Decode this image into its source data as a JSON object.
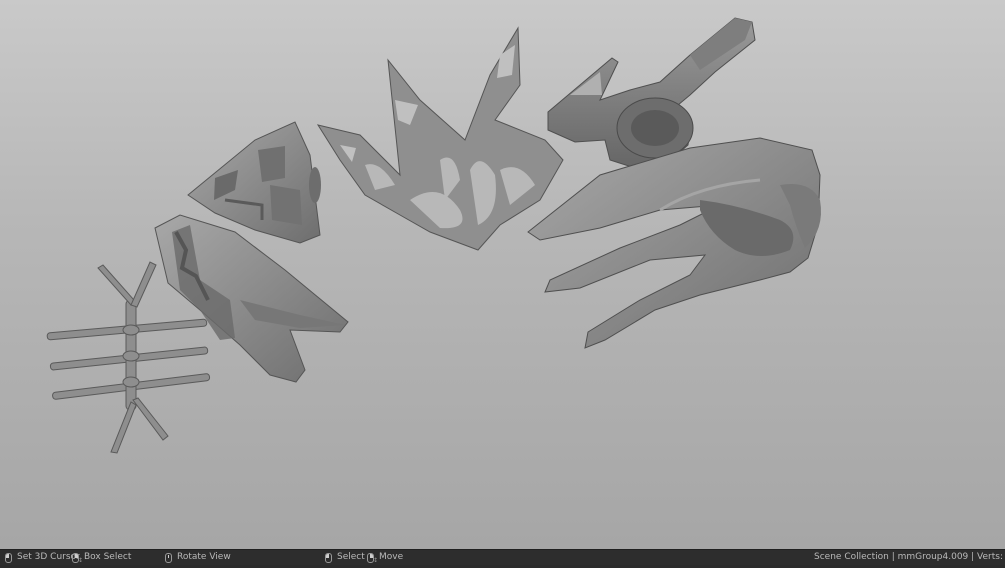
{
  "viewport": {
    "background_top": "#c9c9c9",
    "background_bottom": "#a6a6a6",
    "mesh_color": "#8a8a8a",
    "mesh_shadow": "#5f5f5f",
    "mesh_highlight": "#b5b5b5"
  },
  "statusbar": {
    "hints": [
      {
        "icon": "mouse-left-icon",
        "label": "Set 3D Cursor"
      },
      {
        "icon": "mouse-right-drag-icon",
        "label": "Box Select"
      },
      {
        "icon": "mouse-middle-icon",
        "label": "Rotate View"
      },
      {
        "icon": "mouse-left-icon",
        "label": "Select"
      },
      {
        "icon": "mouse-right-drag-icon",
        "label": "Move"
      }
    ],
    "scene_info": "Scene Collection | mmGroup4.009 | Verts:"
  }
}
